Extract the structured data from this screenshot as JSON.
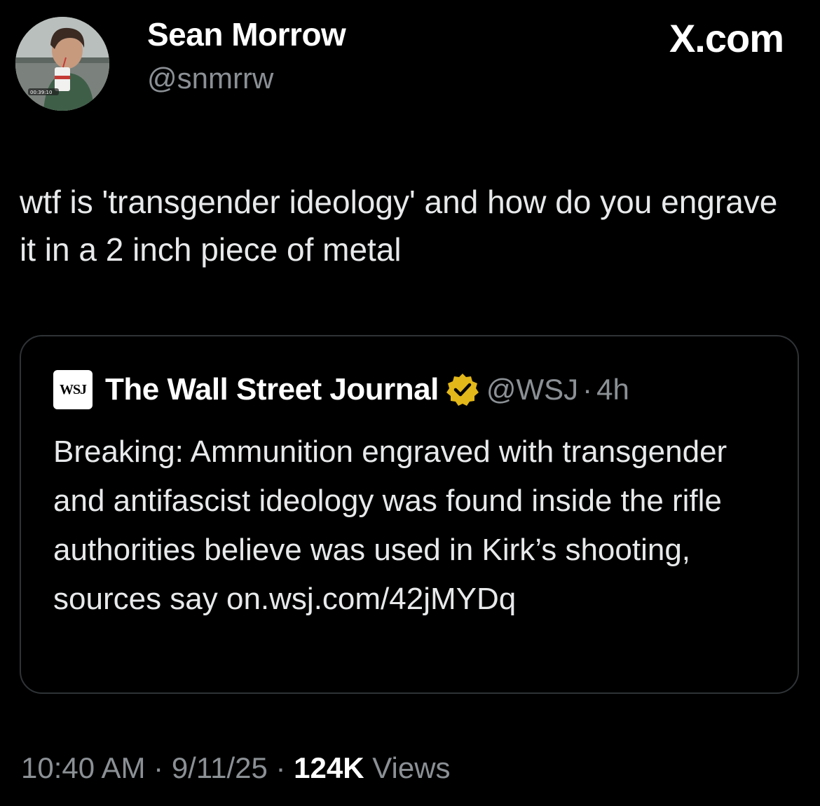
{
  "author": {
    "name": "Sean Morrow",
    "handle": "@snmrrw",
    "avatar_timestamp": "00:39:10"
  },
  "site_mark": "X.com",
  "tweet": {
    "text": "wtf is 'transgender ideology' and how do you engrave it in a 2 inch piece of metal"
  },
  "quoted_tweet": {
    "logo_text": "WSJ",
    "name": "The Wall Street Journal",
    "verified": true,
    "verified_color": "#e2b719",
    "handle": "@WSJ",
    "separator": "·",
    "time": "4h",
    "text": "Breaking: Ammunition engraved with transgender and antifascist ideology was found inside the rifle authorities believe was used in Kirk’s shooting, sources say on.wsj.com/42jMYDq"
  },
  "meta": {
    "time": "10:40 AM",
    "separator": "·",
    "date": "9/11/25",
    "views_count": "124K",
    "views_label": "Views"
  },
  "colors": {
    "background": "#000000",
    "primary_text": "#e7e9ea",
    "secondary_text": "#8b9095",
    "border": "#2f3336"
  }
}
